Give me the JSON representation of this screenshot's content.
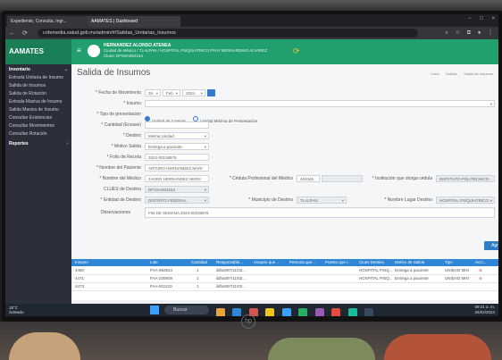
{
  "browser": {
    "tabs": [
      {
        "label": "Expediente, Consulta, Ingr..."
      },
      {
        "label": "AAMATES | Dashboard"
      }
    ],
    "url": "cofemedia.salud.gob.mx/admin/#/Salidas_Unitarias_Insumos",
    "window_controls": [
      "−",
      "□",
      "×"
    ]
  },
  "app": {
    "logo": "AAMATES",
    "user_name": "HERNANDEZ ALONSO ATENEA",
    "user_unit": "Ciudad de México / TLALPAN / HOSPITAL PSIQUIATRICO FRAY BERNARDINO ALVAREZ",
    "user_clues": "Clues: DFSSA004154"
  },
  "sidebar": {
    "items": [
      {
        "label": "Inventario",
        "section": true
      },
      {
        "label": "Entrada Unitaria de Insumo",
        "section": false
      },
      {
        "label": "Salida de Insumos",
        "section": false
      },
      {
        "label": "Salida de Rotación",
        "section": false
      },
      {
        "label": "Entrada Masiva de Insumo",
        "section": false
      },
      {
        "label": "Salida Masiva de Insumo",
        "section": false
      },
      {
        "label": "Consultar Existencias",
        "section": false
      },
      {
        "label": "Consultar Movimientos",
        "section": false
      },
      {
        "label": "Consultar Rotación",
        "section": false
      },
      {
        "label": "Reportes",
        "section": true
      }
    ]
  },
  "page": {
    "title": "Salida de Insumos",
    "breadcrumb": [
      "Inicio",
      "Salidas",
      "Salida de Insumos"
    ]
  },
  "form": {
    "fecha_label": "* Fecha de Movimiento",
    "fecha_day": "26",
    "fecha_month": "Feb",
    "fecha_year": "2024",
    "insumo_label": "* Insumo",
    "tipo_label": "* Tipo de presentación",
    "tipo_opt1": "Unidad de Compra",
    "tipo_opt2": "Unidad Mínima de Presentación",
    "cantidad_label": "* Cantidad (Envase)",
    "destino_label": "* Destino",
    "destino_value": "Misma Unidad",
    "motivo_label": "* Motivo Salida",
    "motivo_value": "Entrega a paciente",
    "folio_label": "* Folio de Receta",
    "folio_value": "2024-00108976",
    "paciente_label": "* Nombre del Paciente",
    "paciente_value": "ARTURO HERNANDEZ MARI",
    "medico_label": "* Nombre del Médico",
    "medico_value": "JAVIER HERNANDEZ HERN",
    "cedula_label": "* Cédula Profesional del Médico",
    "cedula_value": "404045",
    "institucion_label": "* Institución que otorga cédula",
    "institucion_value": "INSTITUTO POLITECNICO",
    "clues_label": "CLUES de Destino",
    "clues_value": "DFSSA004154",
    "entidad_label": "* Entidad de Destino",
    "entidad_value": "DISTRITO FEDERAL",
    "municipio_label": "* Municipio de Destino",
    "municipio_value": "TLALPAN",
    "lugar_label": "* Nombre Lugar Destino",
    "lugar_value": "HOSPITAL PSIQUIATRICO",
    "obs_label": "Observaciones",
    "obs_value": "FIN DE SEMANA 2024-00108976",
    "add_button": "Agregar"
  },
  "table": {
    "headers": [
      "Insumo",
      "Lote",
      "Cantidad",
      "Responsable...",
      "Usuario que ...",
      "Persona que ...",
      "Puesto que r...",
      "Clues Destino",
      "Motivo de Salida",
      "Tipo",
      "Acci..."
    ],
    "rows": [
      {
        "insumo": "4480",
        "lote": "FAA-993543",
        "cantidad": "1",
        "responsable": "ildha097/11/02...",
        "clues": "HOSPITAL PSIQ...",
        "motivo": "Entrega a paciente",
        "tipo": "UNIDAD MIN"
      },
      {
        "insumo": "4471",
        "lote": "FAA-230609",
        "cantidad": "1",
        "responsable": "ildha097/11/02...",
        "clues": "HOSPITAL PSIQ...",
        "motivo": "Entrega a paciente",
        "tipo": "UNIDAD MIN"
      },
      {
        "insumo": "4473",
        "lote": "FAA-911210",
        "cantidad": "1",
        "responsable": "ildha097/11/02...",
        "clues": "",
        "motivo": "",
        "tipo": ""
      }
    ]
  },
  "taskbar": {
    "weather_temp": "18°C",
    "weather_desc": "Soleado",
    "search": "Buscar",
    "time": "09:21 a. m.",
    "date": "26/02/2024",
    "icon_colors": [
      "#e6a23c",
      "#2f86d6",
      "#d9534f",
      "#f0c419",
      "#3aa0ff",
      "#27ae60",
      "#9b59b6",
      "#e74c3c",
      "#1abc9c",
      "#34495e"
    ]
  },
  "bezel": {
    "brand": "hp"
  }
}
